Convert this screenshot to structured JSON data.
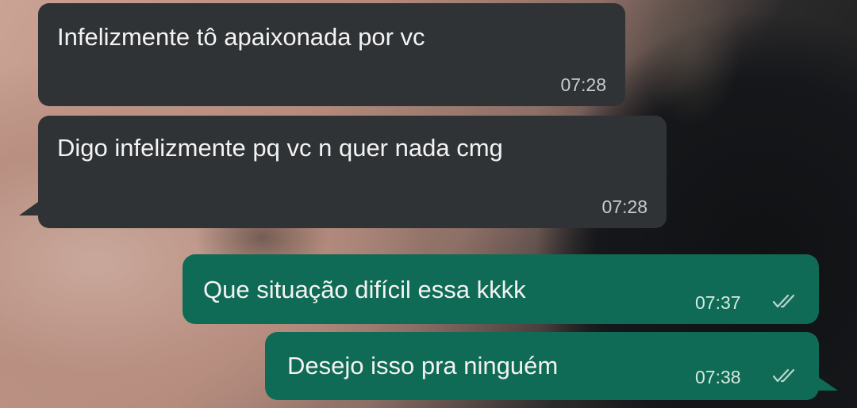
{
  "messages": [
    {
      "direction": "incoming",
      "text": "Infelizmente tô apaixonada por vc",
      "time": "07:28"
    },
    {
      "direction": "incoming",
      "text": "Digo infelizmente pq vc n quer nada cmg",
      "time": "07:28"
    },
    {
      "direction": "outgoing",
      "text": "Que situação difícil essa kkkk",
      "time": "07:37",
      "status": "read"
    },
    {
      "direction": "outgoing",
      "text": "Desejo isso pra ninguém",
      "time": "07:38",
      "status": "read"
    }
  ],
  "colors": {
    "incoming_bubble": "#2f3336",
    "outgoing_bubble": "#0f6b55",
    "text": "#f3f3f3"
  }
}
